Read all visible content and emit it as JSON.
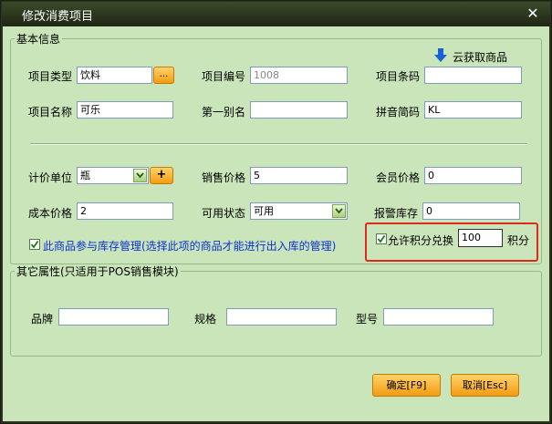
{
  "window": {
    "title": "修改消费项目"
  },
  "basic": {
    "legend": "基本信息",
    "cloud_button": "云获取商品",
    "item_type_label": "项目类型",
    "item_type_value": "饮料",
    "item_type_button": "...",
    "item_code_label": "项目编号",
    "item_code_value": "1008",
    "item_barcode_label": "项目条码",
    "item_barcode_value": "",
    "item_name_label": "项目名称",
    "item_name_value": "可乐",
    "alias_label": "第一别名",
    "alias_value": "",
    "pinyin_label": "拼音简码",
    "pinyin_value": "KL",
    "unit_label": "计价单位",
    "unit_value": "瓶",
    "unit_add_button": "+",
    "sale_price_label": "销售价格",
    "sale_price_value": "5",
    "member_price_label": "会员价格",
    "member_price_value": "0",
    "cost_price_label": "成本价格",
    "cost_price_value": "2",
    "status_label": "可用状态",
    "status_value": "可用",
    "alarm_stock_label": "报警库存",
    "alarm_stock_value": "0",
    "inventory_checkbox_label": "此商品参与库存管理(选择此项的商品才能进行出入库的管理)",
    "inventory_checked": true,
    "points_checkbox_label": "允许积分兑换",
    "points_checked": true,
    "points_value": "100",
    "points_unit": "积分"
  },
  "other": {
    "legend": "其它属性(只适用于POS销售模块)",
    "brand_label": "品牌",
    "brand_value": "",
    "spec_label": "规格",
    "spec_value": "",
    "model_label": "型号",
    "model_value": ""
  },
  "buttons": {
    "ok": "确定[F9]",
    "cancel": "取消[Esc]"
  },
  "colors": {
    "accent_orange": "#f39c12",
    "highlight_red": "#e0291e",
    "link_blue": "#0b2fd6",
    "client_bg": "#c9e5b9"
  }
}
